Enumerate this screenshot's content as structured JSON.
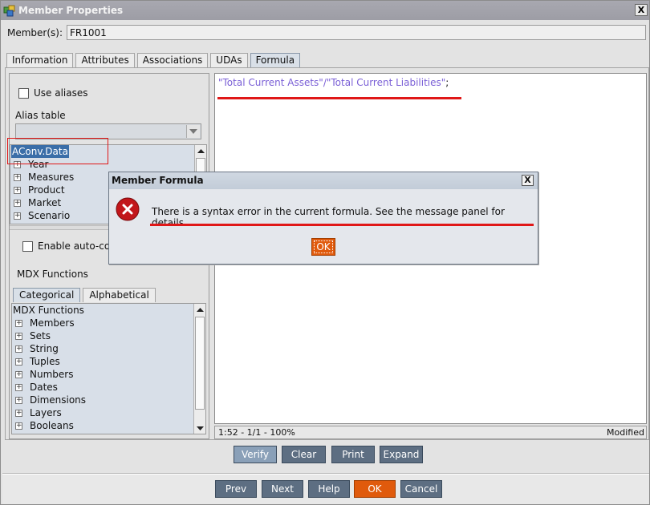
{
  "window": {
    "title": "Member Properties",
    "close": "X"
  },
  "member": {
    "label": "Member(s):",
    "value": "FR1001"
  },
  "tabs": [
    {
      "label": "Information"
    },
    {
      "label": "Attributes"
    },
    {
      "label": "Associations"
    },
    {
      "label": "UDAs"
    },
    {
      "label": "Formula",
      "active": true
    }
  ],
  "left_panel": {
    "use_aliases_label": "Use aliases",
    "alias_table_label": "Alias table",
    "alias_table_value": "",
    "outline_tree": {
      "root": "AConv.Data",
      "children": [
        "Year",
        "Measures",
        "Product",
        "Market",
        "Scenario"
      ]
    },
    "enable_autocomplete_label": "Enable auto-co",
    "mdx_functions_label": "MDX Functions",
    "subtabs": [
      {
        "label": "Categorical",
        "active": true
      },
      {
        "label": "Alphabetical"
      }
    ],
    "mdx_tree": {
      "root": "MDX Functions",
      "children": [
        "Members",
        "Sets",
        "String",
        "Tuples",
        "Numbers",
        "Dates",
        "Dimensions",
        "Layers",
        "Booleans"
      ]
    }
  },
  "editor": {
    "formula": "\"Total Current Assets\"/\"Total Current Liabilities\"",
    "terminator": ";"
  },
  "status": {
    "position": "1:52 - 1/1 - 100%",
    "state": "Modified"
  },
  "editor_buttons": {
    "verify": "Verify",
    "clear": "Clear",
    "print": "Print",
    "expand": "Expand"
  },
  "footer_buttons": {
    "prev": "Prev",
    "next": "Next",
    "help": "Help",
    "ok": "OK",
    "cancel": "Cancel"
  },
  "dialog": {
    "title": "Member Formula",
    "close": "X",
    "message": "There is a syntax error in the current formula. See the message panel for details.",
    "ok": "OK"
  },
  "colors": {
    "accent_orange": "#e05a0c",
    "button_slate": "#5d6e82",
    "annotation_red": "#e01818",
    "formula_text": "#7a5fd6",
    "selection_blue": "#3b6ea8"
  }
}
